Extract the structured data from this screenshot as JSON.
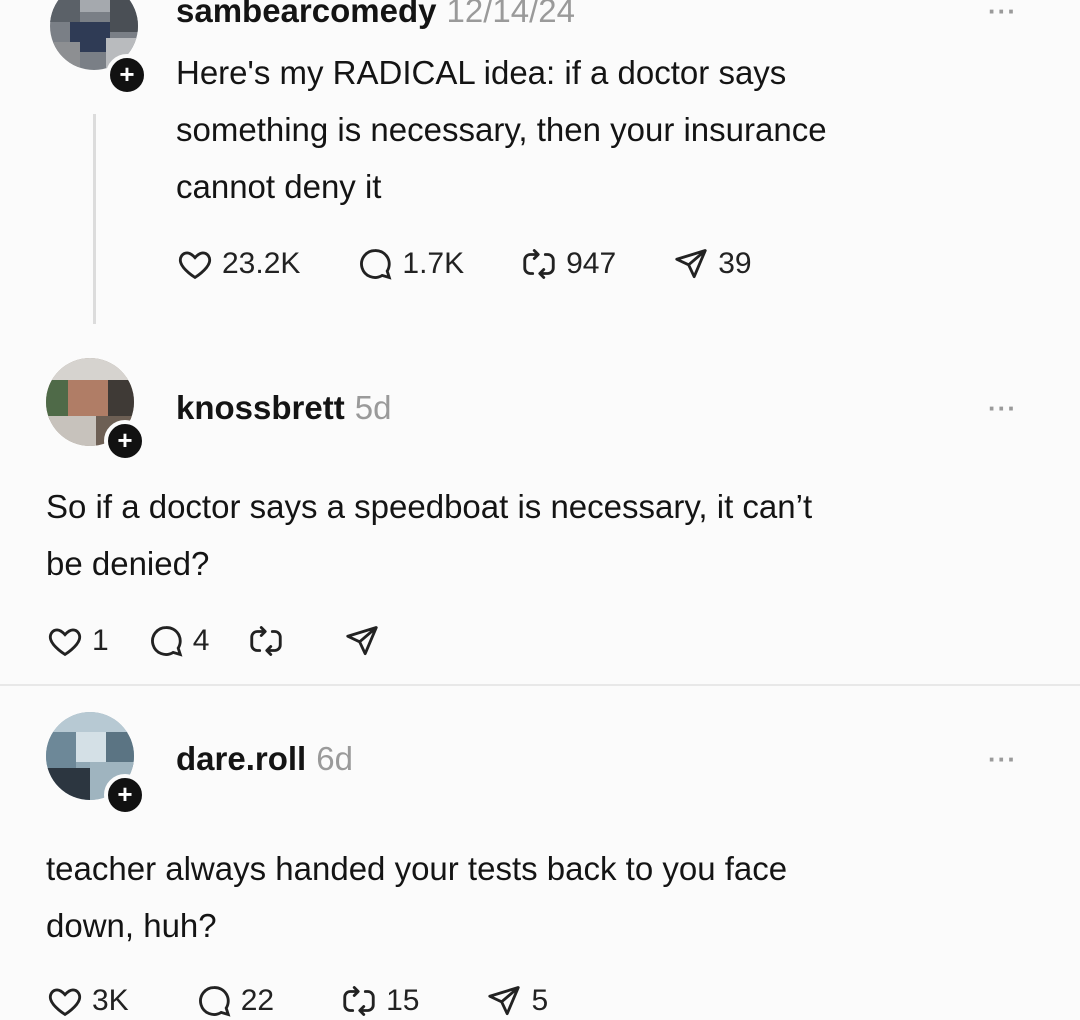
{
  "posts": [
    {
      "username": "sambearcomedy",
      "time": "12/14/24",
      "text_lines": [
        "Here's my RADICAL idea: if a doctor says",
        "something is necessary, then your  insurance",
        "cannot deny it"
      ],
      "likes": "23.2K",
      "replies": "1.7K",
      "reposts": "947",
      "shares": "39"
    },
    {
      "username": "knossbrett",
      "time": "5d",
      "text_lines": [
        "So if a doctor says a speedboat is necessary, it can’t",
        "be denied?"
      ],
      "likes": "1",
      "replies": "4",
      "reposts": "",
      "shares": ""
    },
    {
      "username": "dare.roll",
      "time": "6d",
      "text_lines": [
        "teacher always handed your tests back to you face",
        "down, huh?"
      ],
      "likes": "3K",
      "replies": "22",
      "reposts": "15",
      "shares": "5"
    }
  ],
  "ui": {
    "more_label": "···",
    "follow_badge": "+"
  },
  "colors": {
    "background": "#fbfbfb",
    "text": "#141414",
    "muted": "#9a9a9a"
  }
}
